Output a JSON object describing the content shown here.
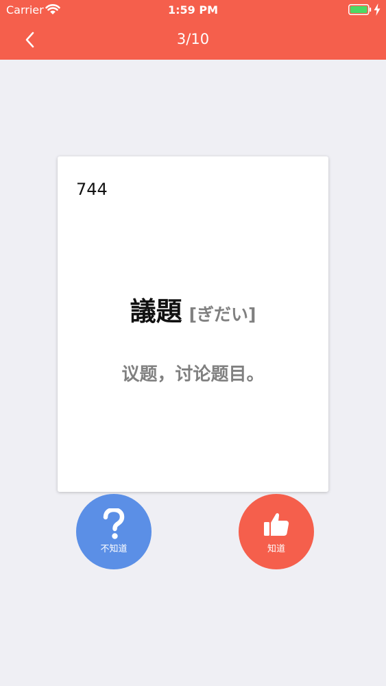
{
  "status_bar": {
    "carrier": "Carrier",
    "time": "1:59 PM"
  },
  "nav": {
    "title": "3/10"
  },
  "card": {
    "number": "744",
    "word": "議題",
    "reading": "[ぎだい]",
    "meaning": "议题，讨论题目。"
  },
  "actions": {
    "unknown_label": "不知道",
    "known_label": "知道"
  },
  "colors": {
    "header": "#f55f4c",
    "unknown_button": "#5b8fe6",
    "known_button": "#f55f4c",
    "background": "#efeff4"
  }
}
